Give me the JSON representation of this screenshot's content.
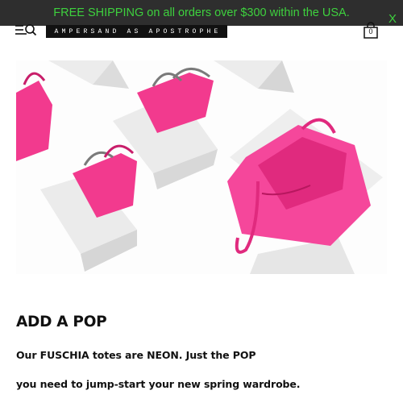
{
  "promo": {
    "text": "FREE SHIPPING on all orders over $300 within the USA.",
    "close_label": "X"
  },
  "header": {
    "logo_text": "AMPERSAND AS APOSTROPHE",
    "cart_count": "0"
  },
  "icons": {
    "menu": "menu-search-icon",
    "cart": "shopping-bag-icon"
  },
  "hero": {
    "image": "pink-fuchsia-totes-on-white-boxes"
  },
  "content": {
    "heading": "ADD A POP",
    "line1": "Our FUSCHIA totes are NEON. Just the POP",
    "line2": "you need to jump-start your new spring wardrobe."
  },
  "colors": {
    "promo_bg": "#2e2e2e",
    "promo_text": "#3ed13e",
    "tote_pink": "#f23a8e"
  }
}
